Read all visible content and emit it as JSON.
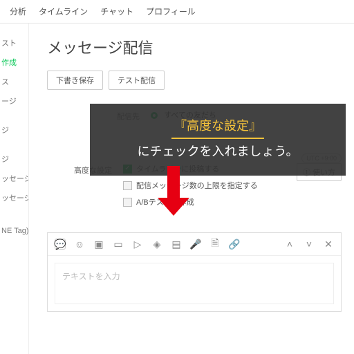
{
  "topnav": {
    "items": [
      "分析",
      "タイムライン",
      "チャット",
      "プロフィール"
    ]
  },
  "sidebar": {
    "items": [
      {
        "label": "スト",
        "active": false
      },
      {
        "label": "作成",
        "active": true
      },
      {
        "label": "ス",
        "active": false
      },
      {
        "label": "ージ",
        "active": false
      },
      {
        "label": "ジ",
        "active": false
      },
      {
        "label": "ジ",
        "active": false
      },
      {
        "label": "ッセージ",
        "active": false
      },
      {
        "label": "ッセージ",
        "active": false
      },
      {
        "label": "NE Tag)",
        "active": false
      }
    ]
  },
  "page": {
    "title": "メッセージ配信"
  },
  "actions": {
    "draft": "下書き保存",
    "test": "テスト配信"
  },
  "form": {
    "dest_label": "配信先",
    "dest_value": "すべての友だち",
    "utc": "UTC +9:00"
  },
  "advanced": {
    "label": "高度な設定",
    "opts": [
      {
        "label": "タイムラインに投稿する",
        "checked": true
      },
      {
        "label": "配信メッセージ数の上限を指定する",
        "checked": false
      },
      {
        "label": "A/Bテストを作成",
        "checked": false
      }
    ],
    "usage_btn": "① 使い方"
  },
  "editor": {
    "placeholder": "テキストを入力",
    "tool_icons": [
      "chat-icon",
      "smile-icon",
      "image-icon",
      "card-icon",
      "video-icon",
      "voice-icon",
      "reserve-icon",
      "mic-icon",
      "file-icon",
      "link-icon"
    ],
    "right_icons": [
      "up-icon",
      "down-icon",
      "close-icon"
    ]
  },
  "overlay": {
    "highlight": "『高度な設定』",
    "rest": "にチェックを入れましょう。"
  }
}
